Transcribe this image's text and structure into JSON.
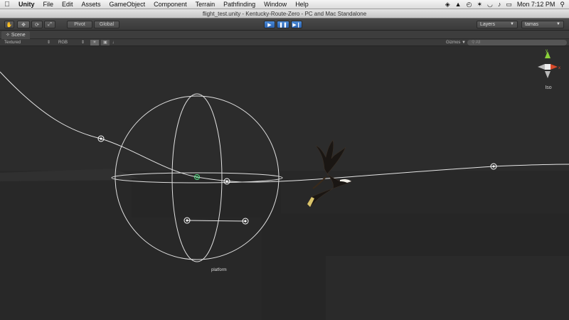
{
  "menubar": {
    "app": "Unity",
    "items": [
      "File",
      "Edit",
      "Assets",
      "GameObject",
      "Component",
      "Terrain",
      "Pathfinding",
      "Window",
      "Help"
    ],
    "clock": "Mon 7:12 PM"
  },
  "window": {
    "title": "flight_test.unity - Kentucky-Route-Zero - PC and Mac Standalone"
  },
  "toolbar": {
    "pivot_label": "Pivot",
    "global_label": "Global",
    "layers_label": "Layers",
    "layout_label": "tamas"
  },
  "scene": {
    "tab_label": "Scene",
    "render_mode": "Textured",
    "color_mode": "RGB",
    "gizmos_label": "Gizmos",
    "search_placeholder": "All",
    "iso_label": "Iso",
    "object_label": "platform",
    "gizmo_x_label": "x",
    "gizmo_y_label": "y"
  },
  "colors": {
    "gizmo_x": "#d94a2a",
    "gizmo_y": "#8ad13a",
    "play_accent": "#3a78c8"
  }
}
